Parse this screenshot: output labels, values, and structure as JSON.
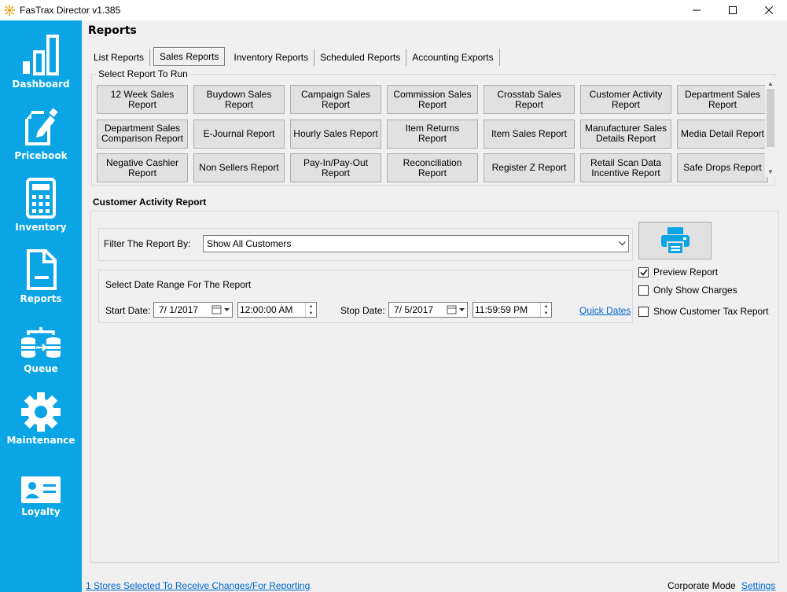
{
  "window": {
    "title": "FasTrax Director v1.385"
  },
  "sidebar": {
    "items": [
      {
        "label": "Dashboard",
        "icon": "bar-chart-icon"
      },
      {
        "label": "Pricebook",
        "icon": "edit-document-icon"
      },
      {
        "label": "Inventory",
        "icon": "calculator-icon"
      },
      {
        "label": "Reports",
        "icon": "report-document-icon"
      },
      {
        "label": "Queue",
        "icon": "database-sync-icon"
      },
      {
        "label": "Maintenance",
        "icon": "gear-icon"
      },
      {
        "label": "Loyalty",
        "icon": "id-card-icon"
      }
    ]
  },
  "main": {
    "title": "Reports",
    "tabs": [
      {
        "label": "List Reports",
        "active": false
      },
      {
        "label": "Sales Reports",
        "active": true
      },
      {
        "label": "Inventory Reports",
        "active": false
      },
      {
        "label": "Scheduled Reports",
        "active": false
      },
      {
        "label": "Accounting Exports",
        "active": false
      }
    ],
    "select_legend": "Select Report To Run",
    "reports": [
      [
        "12 Week Sales",
        "Report"
      ],
      [
        "Buydown Sales",
        "Report"
      ],
      [
        "Campaign Sales",
        "Report"
      ],
      [
        "Commission Sales",
        "Report"
      ],
      [
        "Crosstab Sales",
        "Report"
      ],
      [
        "Customer Activity",
        "Report"
      ],
      [
        "Department Sales",
        "Report"
      ],
      [
        "Department Sales",
        "Comparison Report"
      ],
      [
        "E-Journal Report"
      ],
      [
        "Hourly Sales Report"
      ],
      [
        "Item Returns Report"
      ],
      [
        "Item Sales Report"
      ],
      [
        "Manufacturer Sales",
        "Details Report"
      ],
      [
        "Media Detail Report"
      ],
      [
        "Negative Cashier",
        "Report"
      ],
      [
        "Non Sellers Report"
      ],
      [
        "Pay-In/Pay-Out",
        "Report"
      ],
      [
        "Reconciliation Report"
      ],
      [
        "Register Z Report"
      ],
      [
        "Retail Scan Data",
        "Incentive Report"
      ],
      [
        "Safe Drops Report"
      ]
    ],
    "section_title": "Customer Activity Report",
    "filter": {
      "label": "Filter The Report By:",
      "value": "Show All Customers"
    },
    "date_range": {
      "header": "Select Date Range For The Report",
      "start_label": "Start Date:",
      "start_date": "7/  1/2017",
      "start_time": "12:00:00 AM",
      "stop_label": "Stop Date:",
      "stop_date": "7/  5/2017",
      "stop_time": "11:59:59 PM",
      "quick_dates": "Quick Dates"
    },
    "options": [
      {
        "label": "Preview Report",
        "checked": true
      },
      {
        "label": "Only Show Charges",
        "checked": false
      },
      {
        "label": "Show Customer Tax Report",
        "checked": false
      }
    ]
  },
  "footer": {
    "stores": "1 Stores Selected To Receive Changes/For Reporting",
    "mode": "Corporate Mode",
    "settings": "Settings"
  },
  "colors": {
    "sidebar": "#0ba5e6",
    "printer": "#0ba5e6",
    "link": "#0066cc"
  }
}
